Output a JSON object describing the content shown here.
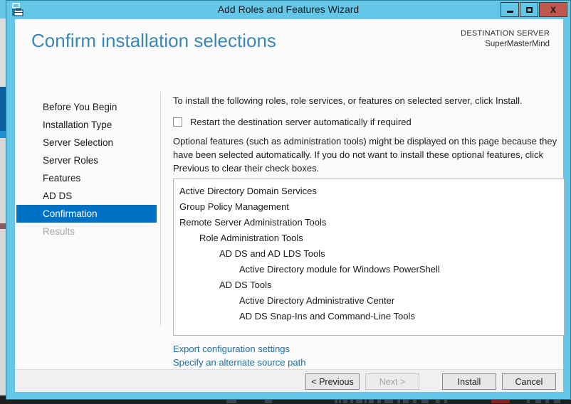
{
  "window": {
    "title": "Add Roles and Features Wizard",
    "icon": "server-toolbox-icon",
    "controls": {
      "minimize_label": "",
      "maximize_label": "",
      "close_label": "X"
    },
    "accent_color": "#64c7e8",
    "close_color": "#c0584f"
  },
  "header": {
    "page_title": "Confirm installation selections",
    "destination_label": "DESTINATION SERVER",
    "destination_value": "SuperMasterMind",
    "title_color": "#3a87b5"
  },
  "sidebar": {
    "highlight_color": "#0072c6",
    "items": [
      {
        "label": "Before You Begin",
        "state": "normal"
      },
      {
        "label": "Installation Type",
        "state": "normal"
      },
      {
        "label": "Server Selection",
        "state": "normal"
      },
      {
        "label": "Server Roles",
        "state": "normal"
      },
      {
        "label": "Features",
        "state": "normal"
      },
      {
        "label": "AD DS",
        "state": "normal"
      },
      {
        "label": "Confirmation",
        "state": "active"
      },
      {
        "label": "Results",
        "state": "disabled"
      }
    ]
  },
  "main": {
    "intro_text": "To install the following roles, role services, or features on selected server, click Install.",
    "restart_checkbox": {
      "label": "Restart the destination server automatically if required",
      "checked": false
    },
    "optional_text": "Optional features (such as administration tools) might be displayed on this page because they have been selected automatically. If you do not want to install these optional features, click Previous to clear their check boxes.",
    "feature_list": [
      {
        "label": "Active Directory Domain Services",
        "indent": 0
      },
      {
        "label": "Group Policy Management",
        "indent": 0
      },
      {
        "label": "Remote Server Administration Tools",
        "indent": 0
      },
      {
        "label": "Role Administration Tools",
        "indent": 1
      },
      {
        "label": "AD DS and AD LDS Tools",
        "indent": 2
      },
      {
        "label": "Active Directory module for Windows PowerShell",
        "indent": 3
      },
      {
        "label": "AD DS Tools",
        "indent": 2
      },
      {
        "label": "Active Directory Administrative Center",
        "indent": 3
      },
      {
        "label": "AD DS Snap-Ins and Command-Line Tools",
        "indent": 3
      }
    ],
    "links": [
      {
        "label": "Export configuration settings"
      },
      {
        "label": "Specify an alternate source path"
      }
    ],
    "link_color": "#1a6fa8"
  },
  "footer": {
    "buttons": [
      {
        "label": "< Previous",
        "state": "enabled"
      },
      {
        "label": "Next >",
        "state": "disabled"
      },
      {
        "label": "Install",
        "state": "enabled"
      },
      {
        "label": "Cancel",
        "state": "enabled"
      }
    ]
  }
}
